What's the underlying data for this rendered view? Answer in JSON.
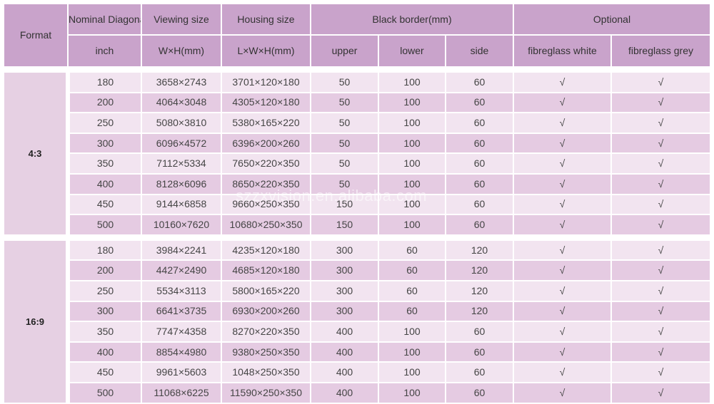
{
  "header": {
    "format": "Format",
    "nominal_diagonal": "Nominal Diagonal",
    "viewing_size": "Viewing size",
    "housing_size": "Housing size",
    "black_border": "Black border(mm)",
    "optional": "Optional",
    "inch": "inch",
    "wxh": "W×H(mm)",
    "lxwxh": "L×W×H(mm)",
    "upper": "upper",
    "lower": "lower",
    "side": "side",
    "fibreglass_white": "fibreglass white",
    "fibreglass_grey": "fibreglass grey"
  },
  "groups": [
    {
      "format": "4:3",
      "rows": [
        {
          "inch": "180",
          "viewing": "3658×2743",
          "housing": "3701×120×180",
          "upper": "50",
          "lower": "100",
          "side": "60",
          "white": "√",
          "grey": "√"
        },
        {
          "inch": "200",
          "viewing": "4064×3048",
          "housing": "4305×120×180",
          "upper": "50",
          "lower": "100",
          "side": "60",
          "white": "√",
          "grey": "√"
        },
        {
          "inch": "250",
          "viewing": "5080×3810",
          "housing": "5380×165×220",
          "upper": "50",
          "lower": "100",
          "side": "60",
          "white": "√",
          "grey": "√"
        },
        {
          "inch": "300",
          "viewing": "6096×4572",
          "housing": "6396×200×260",
          "upper": "50",
          "lower": "100",
          "side": "60",
          "white": "√",
          "grey": "√"
        },
        {
          "inch": "350",
          "viewing": "7112×5334",
          "housing": "7650×220×350",
          "upper": "50",
          "lower": "100",
          "side": "60",
          "white": "√",
          "grey": "√"
        },
        {
          "inch": "400",
          "viewing": "8128×6096",
          "housing": "8650×220×350",
          "upper": "50",
          "lower": "100",
          "side": "60",
          "white": "√",
          "grey": "√"
        },
        {
          "inch": "450",
          "viewing": "9144×6858",
          "housing": "9660×250×350",
          "upper": "150",
          "lower": "100",
          "side": "60",
          "white": "√",
          "grey": "√"
        },
        {
          "inch": "500",
          "viewing": "10160×7620",
          "housing": "10680×250×350",
          "upper": "150",
          "lower": "100",
          "side": "60",
          "white": "√",
          "grey": "√"
        }
      ]
    },
    {
      "format": "16:9",
      "rows": [
        {
          "inch": "180",
          "viewing": "3984×2241",
          "housing": "4235×120×180",
          "upper": "300",
          "lower": "60",
          "side": "120",
          "white": "√",
          "grey": "√"
        },
        {
          "inch": "200",
          "viewing": "4427×2490",
          "housing": "4685×120×180",
          "upper": "300",
          "lower": "60",
          "side": "120",
          "white": "√",
          "grey": "√"
        },
        {
          "inch": "250",
          "viewing": "5534×3113",
          "housing": "5800×165×220",
          "upper": "300",
          "lower": "60",
          "side": "120",
          "white": "√",
          "grey": "√"
        },
        {
          "inch": "300",
          "viewing": "6641×3735",
          "housing": "6930×200×260",
          "upper": "300",
          "lower": "60",
          "side": "120",
          "white": "√",
          "grey": "√"
        },
        {
          "inch": "350",
          "viewing": "7747×4358",
          "housing": "8270×220×350",
          "upper": "400",
          "lower": "100",
          "side": "60",
          "white": "√",
          "grey": "√"
        },
        {
          "inch": "400",
          "viewing": "8854×4980",
          "housing": "9380×250×350",
          "upper": "400",
          "lower": "100",
          "side": "60",
          "white": "√",
          "grey": "√"
        },
        {
          "inch": "450",
          "viewing": "9961×5603",
          "housing": "1048×250×350",
          "upper": "400",
          "lower": "100",
          "side": "60",
          "white": "√",
          "grey": "√"
        },
        {
          "inch": "500",
          "viewing": "11068×6225",
          "housing": "11590×250×350",
          "upper": "400",
          "lower": "100",
          "side": "60",
          "white": "√",
          "grey": "√"
        }
      ]
    }
  ],
  "watermark": "szzxvision.en.alibaba.com",
  "colors": {
    "header_bg": "#c9a3cb",
    "format_cell_bg": "#e6d0e3",
    "row_light": "#f2e4f0",
    "row_dark": "#e5cbe2"
  }
}
